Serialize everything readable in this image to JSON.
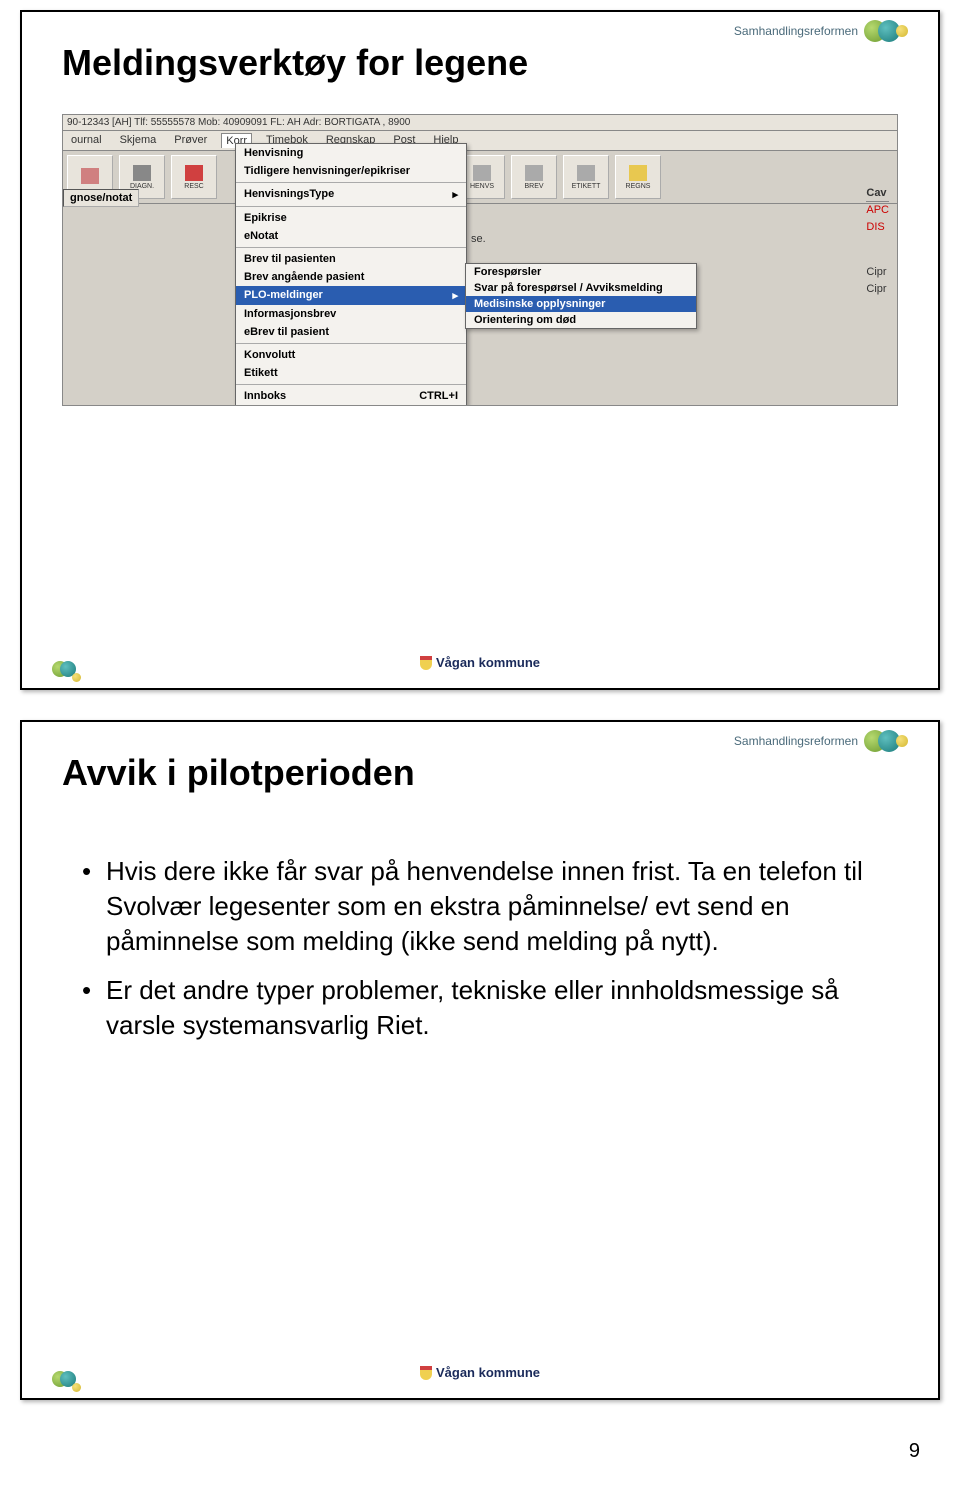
{
  "slide1": {
    "header_label": "Samhandlingsreformen",
    "title": "Meldingsverktøy for legene",
    "addr_bar": "90-12343 [AH] Tlf: 55555578 Mob: 40909091 FL: AH Adr: BORTIGATA , 8900",
    "menubar": [
      "ournal",
      "Skjema",
      "Prøver",
      "Korr",
      "Timebok",
      "Regnskap",
      "Post",
      "Hjelp"
    ],
    "toolbar_buttons": [
      "",
      "DIAGN.",
      "RESC",
      "",
      "",
      "HENVS",
      "BREV",
      "ETIKETT",
      "REGNS"
    ],
    "gnose": "gnose/notat",
    "se_label": "se.",
    "dropdown": {
      "group1": [
        "Henvisning",
        "Tidligere henvisninger/epikriser"
      ],
      "group2": [
        {
          "label": "HenvisningsType",
          "arrow": "▸"
        }
      ],
      "group3": [
        "Epikrise",
        "eNotat"
      ],
      "group4": [
        "Brev til pasienten",
        "Brev angående pasient",
        "PLO-meldinger",
        "Informasjonsbrev",
        "eBrev til pasient"
      ],
      "group5": [
        "Konvolutt",
        "Etikett"
      ],
      "group6": [
        {
          "label": "Innboks",
          "shortcut": "CTRL+I"
        }
      ]
    },
    "submenu": [
      "Forespørsler",
      "Svar på forespørsel / Avviksmelding",
      "Medisinske opplysninger",
      "Orientering om død"
    ],
    "side_panel": {
      "header": "Cav",
      "items_red": [
        "APC",
        "DIS"
      ],
      "items_blk": [
        "Cipr",
        "Cipr"
      ]
    },
    "footer": "Vågan kommune"
  },
  "slide2": {
    "header_label": "Samhandlingsreformen",
    "title": "Avvik i pilotperioden",
    "bullets": [
      "Hvis dere ikke får svar på henvendelse innen frist. Ta en telefon til Svolvær legesenter som en ekstra påminnelse/ evt send en påminnelse som melding (ikke send melding på nytt).",
      "Er det andre typer problemer, tekniske eller innholdsmessige så varsle systemansvarlig Riet."
    ],
    "footer": "Vågan kommune"
  },
  "page_number": "9"
}
